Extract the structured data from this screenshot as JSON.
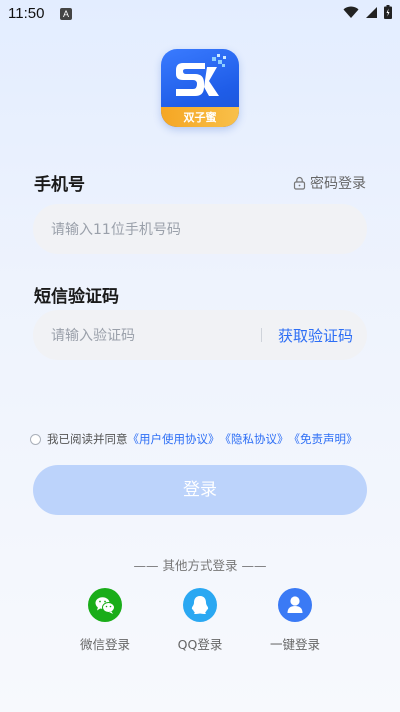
{
  "status": {
    "time": "11:50",
    "notif_letter": "A"
  },
  "logo": {
    "text": "双子蜜",
    "colors": {
      "bg": "#2c6bff",
      "band": "#f5a623"
    }
  },
  "phone": {
    "label": "手机号",
    "password_login": "密码登录",
    "placeholder": "请输入11位手机号码"
  },
  "sms": {
    "label": "短信验证码",
    "placeholder": "请输入验证码",
    "get_code": "获取验证码"
  },
  "agreement": {
    "prefix": "我已阅读并同意",
    "user_agreement": "《用户使用协议》",
    "privacy": "《隐私协议》",
    "disclaimer": "《免责声明》"
  },
  "login_button": "登录",
  "other_login": {
    "title": "—— 其他方式登录 ——",
    "options": [
      {
        "label": "微信登录",
        "icon": "wechat-icon",
        "color": "#1aad19"
      },
      {
        "label": "QQ登录",
        "icon": "qq-icon",
        "color": "#2aa8f2"
      },
      {
        "label": "一键登录",
        "icon": "user-icon",
        "color": "#3a7af5"
      }
    ]
  },
  "colors": {
    "accent": "#2d6ef5",
    "button_disabled": "#bcd3fb"
  }
}
